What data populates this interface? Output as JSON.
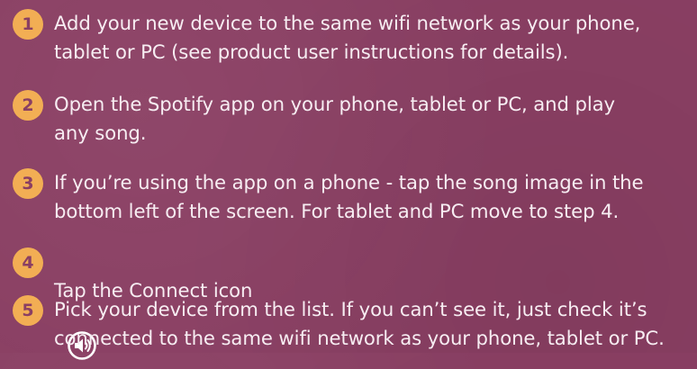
{
  "steps": [
    {
      "number": "1",
      "text": "Add your new device to the same wifi network as your phone,\ntablet or PC (see product user instructions for details)."
    },
    {
      "number": "2",
      "text": "Open the Spotify app on your phone, tablet or PC, and play\nany song."
    },
    {
      "number": "3",
      "text": "If you’re using the app on a phone - tap the song image in the\nbottom left of the screen. For tablet and PC move to step 4."
    },
    {
      "number": "4",
      "text": "Tap the Connect icon",
      "icon": "speaker-connect-icon"
    },
    {
      "number": "5",
      "text": "Pick your device from the list. If you can’t see it, just check it’s\nconnected to the same wifi network as your phone, tablet or PC."
    }
  ]
}
